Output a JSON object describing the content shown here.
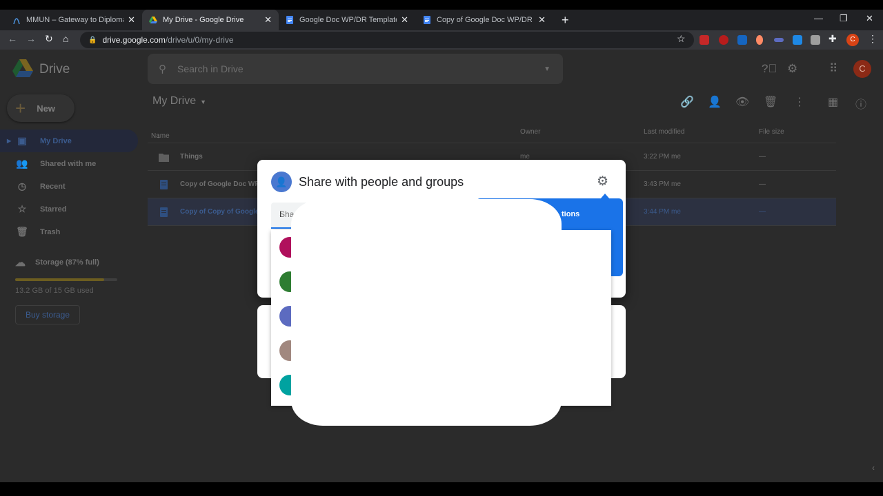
{
  "browser": {
    "tabs": [
      {
        "label": "MMUN – Gateway to Diplomacy",
        "active": false
      },
      {
        "label": "My Drive - Google Drive",
        "active": true
      },
      {
        "label": "Google Doc WP/DR Template - G",
        "active": false
      },
      {
        "label": "Copy of Google Doc WP/DR Tem",
        "active": false
      }
    ],
    "close_glyph": "✕",
    "new_tab_glyph": "+",
    "url_host": "drive.google.com",
    "url_path": "/drive/u/0/my-drive",
    "avatar_letter": "C"
  },
  "drive": {
    "product_name": "Drive",
    "search_placeholder": "Search in Drive",
    "new_button": "New",
    "nav": [
      {
        "label": "My Drive",
        "icon": "my-drive-icon"
      },
      {
        "label": "Shared with me",
        "icon": "people-icon"
      },
      {
        "label": "Recent",
        "icon": "clock-icon"
      },
      {
        "label": "Starred",
        "icon": "star-icon"
      },
      {
        "label": "Trash",
        "icon": "trash-icon"
      }
    ],
    "storage_label": "Storage (87% full)",
    "storage_fraction": 0.87,
    "storage_used": "13.2 GB of 15 GB used",
    "buy_storage": "Buy storage",
    "breadcrumb": "My Drive",
    "avatar_letter": "C",
    "columns": {
      "name": "Name",
      "owner": "Owner",
      "last_modified": "Last modified",
      "file_size": "File size"
    },
    "files": [
      {
        "name": "Things",
        "type": "folder",
        "owner": "me",
        "modified": "3:22 PM",
        "modified_by": "me",
        "size": "—"
      },
      {
        "name": "Copy of Google Doc WP",
        "type": "doc",
        "owner": "",
        "modified": "3:43 PM",
        "modified_by": "me",
        "size": "—"
      },
      {
        "name": "Copy of Copy of Google",
        "type": "doc",
        "owner": "",
        "modified": "3:44 PM",
        "modified_by": "me",
        "size": "—"
      }
    ]
  },
  "share_dialog": {
    "title": "Share with people and groups",
    "input_placeholder": "Sha",
    "tooltip_text": "tions",
    "suggestion_colors": [
      "#b0105c",
      "#2e7d32",
      "#5c6bc0",
      "#a1887f",
      "#00a2a0"
    ]
  },
  "colors": {
    "accent_blue": "#1a73e8",
    "avatar_bg": "#8b2a16"
  }
}
